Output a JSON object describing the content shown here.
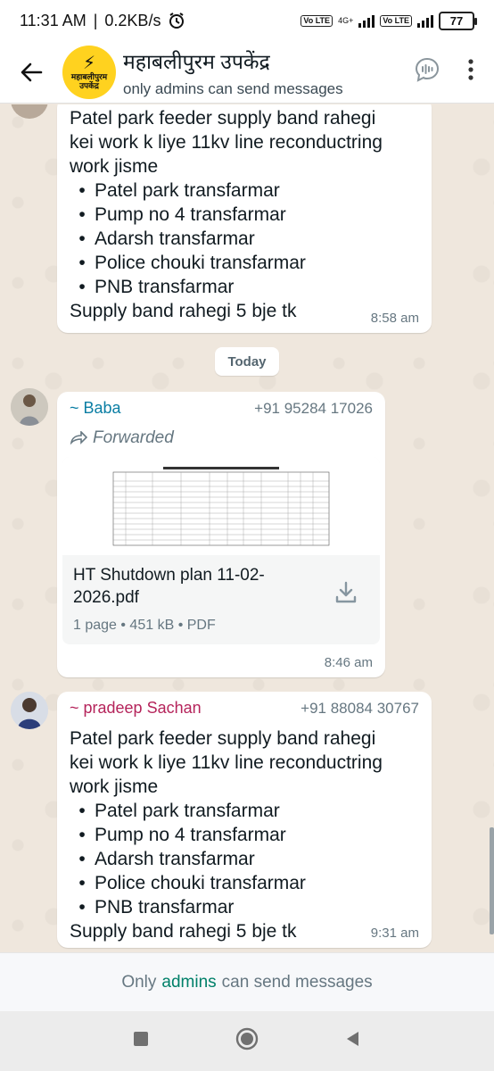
{
  "status_bar": {
    "time": "11:31 AM",
    "speed": "0.2KB/s",
    "network_label": "4G+",
    "volte_label": "Vo LTE",
    "battery": "77"
  },
  "header": {
    "group_name": "महाबलीपुरम उपकेंद्र",
    "subtitle": "only admins can send messages",
    "avatar_text": "महाबलीपुरम उपकेंद्र"
  },
  "messages": [
    {
      "text_lines": [
        "Patel park feeder supply band rahegi",
        "kei work k liye 11kv line reconductring",
        "work jisme"
      ],
      "bullets": [
        "Patel park transfarmar",
        "Pump no 4 transfarmar",
        "Adarsh transfarmar",
        "Police chouki transfarmar",
        "PNB transfarmar"
      ],
      "footer_line": "Supply band rahegi 5 bje tk",
      "time": "8:58 am"
    },
    {
      "sender": "~ Baba",
      "phone": "+91 95284 17026",
      "forwarded": "Forwarded",
      "doc_name": "HT Shutdown plan 11-02-2026.pdf",
      "doc_meta": "1 page • 451 kB • PDF",
      "time": "8:46 am"
    },
    {
      "sender": "~ pradeep Sachan",
      "phone": "+91 88084 30767",
      "text_lines": [
        "Patel park feeder supply band rahegi",
        "kei work k liye 11kv line reconductring",
        "work jisme"
      ],
      "bullets": [
        "Patel park transfarmar",
        "Pump no 4 transfarmar",
        "Adarsh transfarmar",
        "Police chouki transfarmar",
        "PNB transfarmar"
      ],
      "footer_line": "Supply band rahegi 5 bje tk",
      "time": "9:31 am"
    }
  ],
  "date_divider": "Today",
  "footer": {
    "prefix": "Only",
    "admins": "admins",
    "suffix": "can send messages"
  },
  "colors": {
    "accent": "#008069",
    "baba_name": "#0a7ea4",
    "pradeep_name": "#b5245b",
    "chat_bg": "#efe7dd"
  }
}
